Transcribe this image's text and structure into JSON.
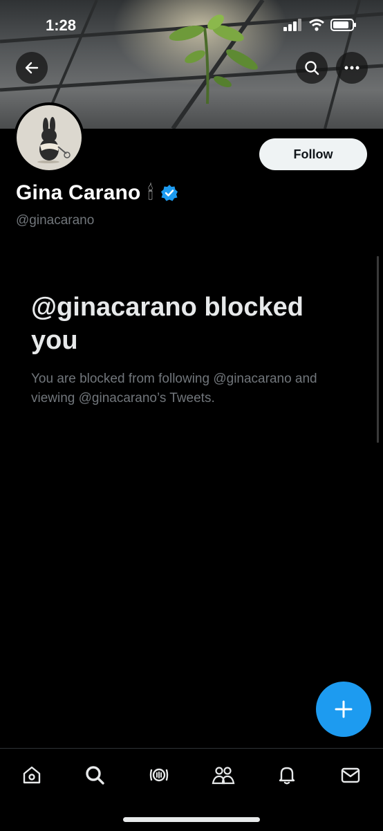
{
  "status_bar": {
    "time": "1:28"
  },
  "profile": {
    "display_name": "Gina Carano",
    "name_emoji": "🕯",
    "handle": "@ginacarano",
    "verified": true,
    "follow_label": "Follow"
  },
  "blocked": {
    "title": "@ginacarano blocked you",
    "message": "You are blocked from following @ginacarano and viewing @ginacarano’s Tweets."
  },
  "colors": {
    "accent": "#1d9bf0",
    "background": "#000000",
    "secondary_text": "#71767b"
  },
  "icons": {
    "back": "arrow-left-icon",
    "search": "search-icon",
    "more": "more-horizontal-icon",
    "verified": "verified-badge-icon",
    "compose": "plus-icon",
    "tabs": [
      "home-icon",
      "search-icon",
      "spaces-icon",
      "communities-icon",
      "notifications-icon",
      "messages-icon"
    ]
  }
}
